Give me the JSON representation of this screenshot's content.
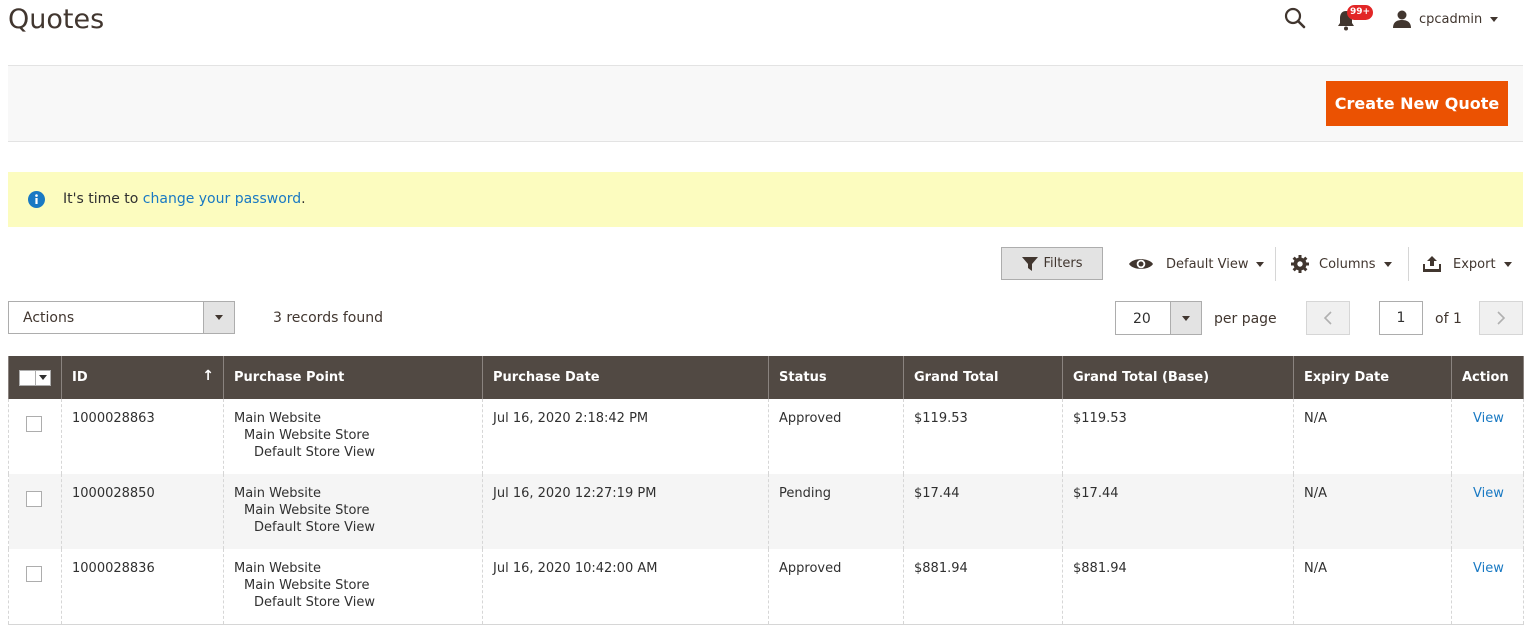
{
  "header": {
    "title": "Quotes",
    "notifications_count": "99+",
    "user_name": "cpcadmin"
  },
  "page_actions": {
    "create_label": "Create New Quote"
  },
  "message": {
    "prefix": "It's time to ",
    "link_text": "change your password",
    "suffix": "."
  },
  "toolbar": {
    "filters_label": "Filters",
    "view_label": "Default View",
    "columns_label": "Columns",
    "export_label": "Export",
    "actions_label": "Actions",
    "records_found": "3 records found",
    "per_page_value": "20",
    "per_page_label": "per page",
    "current_page": "1",
    "of_pages": "of 1"
  },
  "grid": {
    "columns": [
      "ID",
      "Purchase Point",
      "Purchase Date",
      "Status",
      "Grand Total",
      "Grand Total (Base)",
      "Expiry Date",
      "Action"
    ],
    "sort_indicator": "↑",
    "rows": [
      {
        "id": "1000028863",
        "purchase_point": [
          "Main Website",
          "Main Website Store",
          "Default Store View"
        ],
        "purchase_date": "Jul 16, 2020 2:18:42 PM",
        "status": "Approved",
        "grand_total": "$119.53",
        "grand_total_base": "$119.53",
        "expiry_date": "N/A",
        "action": "View"
      },
      {
        "id": "1000028850",
        "purchase_point": [
          "Main Website",
          "Main Website Store",
          "Default Store View"
        ],
        "purchase_date": "Jul 16, 2020 12:27:19 PM",
        "status": "Pending",
        "grand_total": "$17.44",
        "grand_total_base": "$17.44",
        "expiry_date": "N/A",
        "action": "View"
      },
      {
        "id": "1000028836",
        "purchase_point": [
          "Main Website",
          "Main Website Store",
          "Default Store View"
        ],
        "purchase_date": "Jul 16, 2020 10:42:00 AM",
        "status": "Approved",
        "grand_total": "$881.94",
        "grand_total_base": "$881.94",
        "expiry_date": "N/A",
        "action": "View"
      }
    ]
  },
  "colors": {
    "accent": "#eb5202",
    "header_bg": "#514943",
    "link": "#1979c3",
    "message_bg": "#fcfcbf",
    "badge": "#e22626"
  },
  "icons": [
    "search-icon",
    "bell-icon",
    "user-icon",
    "info-icon",
    "filter-icon",
    "eye-icon",
    "gear-icon",
    "upload-icon",
    "chevron-left-icon",
    "chevron-right-icon"
  ]
}
